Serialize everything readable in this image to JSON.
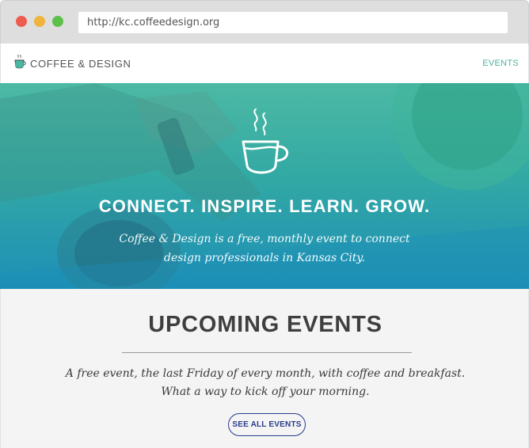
{
  "browser": {
    "url": "http://kc.coffeedesign.org"
  },
  "header": {
    "logo_text": "COFFEE & DESIGN",
    "logo_icon": "coffee-cup-icon",
    "nav_events": "EVENTS"
  },
  "hero": {
    "icon": "coffee-cup-icon",
    "heading": "CONNECT. INSPIRE. LEARN. GROW.",
    "subtext": "Coffee & Design is a free, monthly event to connect design professionals in Kansas City."
  },
  "events": {
    "title": "UPCOMING EVENTS",
    "desc_line1": "A free event, the last Friday of every month, with coffee and breakfast.",
    "desc_line2": "What a way to kick off your morning.",
    "button_label": "SEE ALL EVENTS"
  },
  "colors": {
    "accent_teal": "#49b6a1",
    "hero_top": "#4cb9a4",
    "hero_bottom": "#1d8fb7",
    "button_navy": "#283d8a",
    "traffic_red": "#ee5c4f",
    "traffic_yellow": "#f0b43c",
    "traffic_green": "#5dc04a"
  }
}
